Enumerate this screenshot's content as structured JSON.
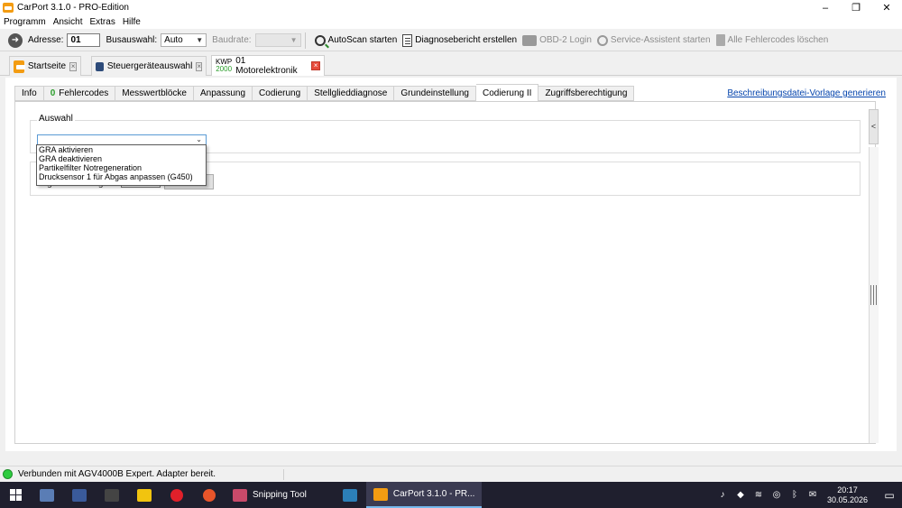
{
  "window": {
    "title": "CarPort 3.1.0  - PRO-Edition",
    "min": "–",
    "max": "❐",
    "close": "✕"
  },
  "menu": [
    "Programm",
    "Ansicht",
    "Extras",
    "Hilfe"
  ],
  "toolbar": {
    "address_label": "Adresse:",
    "address_value": "01",
    "bus_label": "Busauswahl:",
    "bus_value": "Auto",
    "baud_label": "Baudrate:",
    "baud_value": "",
    "autoscan": "AutoScan starten",
    "report": "Diagnosebericht erstellen",
    "obd": "OBD-2 Login",
    "service": "Service-Assistent starten",
    "clear": "Alle Fehlercodes löschen"
  },
  "doc_tabs": [
    {
      "label": "Startseite"
    },
    {
      "label": "Steuergeräteauswahl"
    },
    {
      "label": "01 Motorelektronik",
      "protocol_top": "KWP",
      "protocol_bottom": "2000"
    }
  ],
  "sub_tabs": {
    "info": "Info",
    "fault_count": "0",
    "faults": "Fehlercodes",
    "measure": "Messwertblöcke",
    "adapt": "Anpassung",
    "coding": "Codierung",
    "actuator": "Stellglieddiagnose",
    "basic": "Grundeinstellung",
    "coding2": "Codierung II",
    "access": "Zugriffsberechtigung"
  },
  "generate_link": "Beschreibungsdatei-Vorlage generieren",
  "panel": {
    "group_title": "Auswahl",
    "combo_value": "",
    "login_label": "Login-Code eingeben:",
    "login_button": "Login"
  },
  "dropdown_options": [
    "GRA aktivieren",
    "GRA deaktivieren",
    "Partikelfilter Notregeneration",
    "Drucksensor 1 für Abgas anpassen (G450)"
  ],
  "side_toggle": "<",
  "status": {
    "text": "Verbunden mit AGV4000B Expert. Adapter bereit.",
    "color": "#2ecc40"
  },
  "taskbar": {
    "snipping": "Snipping Tool",
    "carport": "CarPort 3.1.0 - PR...",
    "time": "20:17",
    "date": "30.05.2026",
    "tray_lang": "✉"
  }
}
